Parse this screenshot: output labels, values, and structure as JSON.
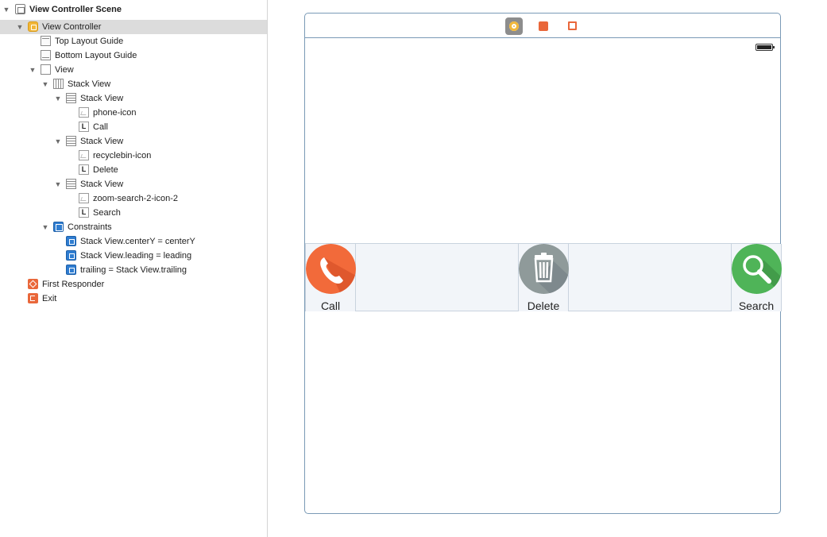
{
  "outline": {
    "scene_title": "View Controller Scene",
    "items": [
      {
        "label": "View Controller Scene",
        "icon": "scene-icon"
      },
      {
        "label": "View Controller",
        "icon": "view-controller-icon"
      },
      {
        "label": "Top Layout Guide",
        "icon": "layout-guide-icon"
      },
      {
        "label": "Bottom Layout Guide",
        "icon": "layout-guide-icon"
      },
      {
        "label": "View",
        "icon": "view-icon"
      },
      {
        "label": "Stack View",
        "icon": "horizontal-stack-icon"
      },
      {
        "label": "Stack View",
        "icon": "vertical-stack-icon"
      },
      {
        "label": "phone-icon",
        "icon": "image-view-icon"
      },
      {
        "label": "Call",
        "icon": "label-icon"
      },
      {
        "label": "Stack View",
        "icon": "vertical-stack-icon"
      },
      {
        "label": "recyclebin-icon",
        "icon": "image-view-icon"
      },
      {
        "label": "Delete",
        "icon": "label-icon"
      },
      {
        "label": "Stack View",
        "icon": "vertical-stack-icon"
      },
      {
        "label": "zoom-search-2-icon-2",
        "icon": "image-view-icon"
      },
      {
        "label": "Search",
        "icon": "label-icon"
      },
      {
        "label": "Constraints",
        "icon": "constraints-icon"
      },
      {
        "label": "Stack View.centerY = centerY",
        "icon": "constraint-icon"
      },
      {
        "label": "Stack View.leading = leading",
        "icon": "constraint-icon"
      },
      {
        "label": "trailing = Stack View.trailing",
        "icon": "constraint-icon"
      },
      {
        "label": "First Responder",
        "icon": "first-responder-icon"
      },
      {
        "label": "Exit",
        "icon": "exit-icon"
      }
    ]
  },
  "canvas": {
    "dock_icons": [
      "view-controller-icon",
      "first-responder-icon",
      "exit-icon"
    ],
    "stack_items": [
      {
        "label": "Call",
        "icon": "phone-icon",
        "color": "#f26a3a"
      },
      {
        "label": "Delete",
        "icon": "recyclebin-icon",
        "color": "#8f9a9a"
      },
      {
        "label": "Search",
        "icon": "zoom-search-icon",
        "color": "#4fb458"
      }
    ]
  },
  "colors": {
    "selection": "#dcdcdc",
    "scene_border": "#7a9ab6",
    "stack_background": "#f2f5f9"
  }
}
